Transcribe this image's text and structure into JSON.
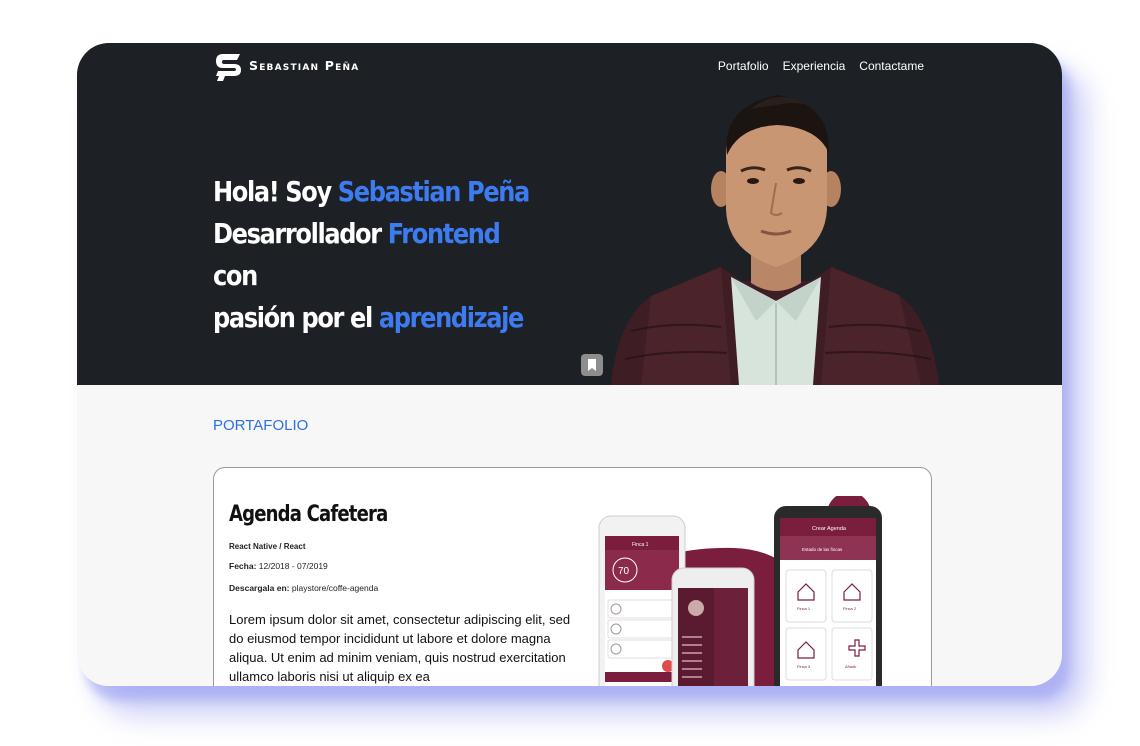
{
  "header": {
    "brand": "Sebastian Peña",
    "nav": [
      "Portafolio",
      "Experiencia",
      "Contactame"
    ]
  },
  "hero": {
    "line1_plain": "Hola! Soy ",
    "line1_highlight": "Sebastian Peña",
    "line2_plain": "Desarrollador ",
    "line2_highlight": "Frontend",
    "line2_suffix": " con",
    "line3_plain": "pasión por el ",
    "line3_highlight": "aprendizaje"
  },
  "portfolio": {
    "section_title": "PORTAFOLIO",
    "project": {
      "title": "Agenda Cafetera",
      "tech": "React Native / React",
      "date_label": "Fecha:",
      "date_value": "12/2018 - 07/2019",
      "download_label": "Descargala en:",
      "download_value": "playstore/coffe-agenda",
      "description": "Lorem ipsum dolor sit amet, consectetur adipiscing elit, sed do eiusmod tempor incididunt ut labore et dolore magna aliqua. Ut enim ad minim veniam, quis nostrud exercitation ullamco laboris nisi ut aliquip ex ea",
      "mockup": {
        "phone1_header": "Finca 1",
        "phone1_temp": "70",
        "phone3_header": "Crear Agenda",
        "phone3_subtitle": "Estado de las fincas",
        "tiles": [
          "Finca 1",
          "Finca 2",
          "Finca 3",
          "Añadir"
        ]
      }
    }
  },
  "colors": {
    "hero_bg": "#1d2126",
    "accent": "#3c7bf0",
    "brand_wine": "#7b1d3c"
  },
  "icons": [
    "logo-icon",
    "bookmark-icon",
    "home-icon",
    "plus-icon"
  ]
}
